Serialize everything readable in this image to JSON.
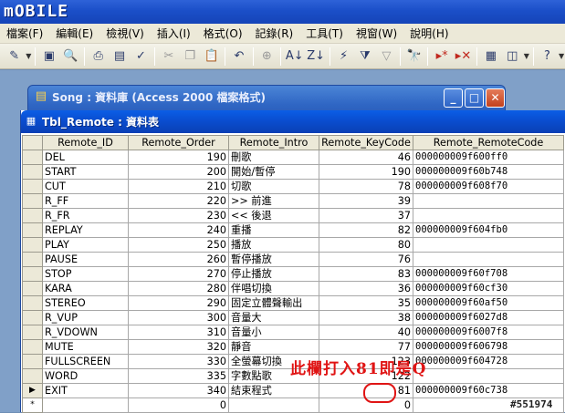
{
  "app": {
    "logo_text": "mOBILE"
  },
  "menu": {
    "items": [
      {
        "label": "檔案(F)"
      },
      {
        "label": "編輯(E)"
      },
      {
        "label": "檢視(V)"
      },
      {
        "label": "插入(I)"
      },
      {
        "label": "格式(O)"
      },
      {
        "label": "記錄(R)"
      },
      {
        "label": "工具(T)"
      },
      {
        "label": "視窗(W)"
      },
      {
        "label": "說明(H)"
      }
    ]
  },
  "toolbar": {
    "buttons": [
      {
        "name": "design-view-icon",
        "glyph": "✎"
      },
      {
        "name": "save-icon",
        "glyph": "▣"
      },
      {
        "name": "file-search-icon",
        "glyph": "🔍"
      },
      {
        "name": "print-icon",
        "glyph": "⎙"
      },
      {
        "name": "print-preview-icon",
        "glyph": "▤"
      },
      {
        "name": "spelling-icon",
        "glyph": "✓"
      },
      {
        "name": "cut-icon",
        "glyph": "✂"
      },
      {
        "name": "copy-icon",
        "glyph": "❐"
      },
      {
        "name": "paste-icon",
        "glyph": "📋"
      },
      {
        "name": "undo-icon",
        "glyph": "↶"
      },
      {
        "name": "hyperlink-icon",
        "glyph": "⊕"
      },
      {
        "name": "sort-ascending-icon",
        "glyph": "A↓"
      },
      {
        "name": "sort-descending-icon",
        "glyph": "Z↓"
      },
      {
        "name": "filter-by-selection-icon",
        "glyph": "⚡"
      },
      {
        "name": "filter-by-form-icon",
        "glyph": "⧩"
      },
      {
        "name": "apply-filter-icon",
        "glyph": "▽"
      },
      {
        "name": "find-icon",
        "glyph": "🔭"
      },
      {
        "name": "new-record-icon",
        "glyph": "▸*"
      },
      {
        "name": "delete-record-icon",
        "glyph": "▸✕"
      },
      {
        "name": "properties-icon",
        "glyph": "▦"
      },
      {
        "name": "new-object-icon",
        "glyph": "◫"
      },
      {
        "name": "help-icon",
        "glyph": "?"
      }
    ]
  },
  "db_window": {
    "title": "Song : 資料庫 (Access 2000 檔案格式)"
  },
  "table_window": {
    "title": "Tbl_Remote : 資料表"
  },
  "grid": {
    "columns": [
      "Remote_ID",
      "Remote_Order",
      "Remote_Intro",
      "Remote_KeyCode",
      "Remote_RemoteCode"
    ],
    "rows": [
      [
        "DEL",
        "190",
        "刪歌",
        "46",
        "000000009f600ff0"
      ],
      [
        "START",
        "200",
        "開始/暫停",
        "190",
        "000000009f60b748"
      ],
      [
        "CUT",
        "210",
        "切歌",
        "78",
        "000000009f608f70"
      ],
      [
        "R_FF",
        "220",
        ">> 前進",
        "39",
        ""
      ],
      [
        "R_FR",
        "230",
        "<< 後退",
        "37",
        ""
      ],
      [
        "REPLAY",
        "240",
        "重播",
        "82",
        "000000009f604fb0"
      ],
      [
        "PLAY",
        "250",
        "播放",
        "80",
        ""
      ],
      [
        "PAUSE",
        "260",
        "暫停播放",
        "76",
        ""
      ],
      [
        "STOP",
        "270",
        "停止播放",
        "83",
        "000000009f60f708"
      ],
      [
        "KARA",
        "280",
        "伴唱切換",
        "36",
        "000000009f60cf30"
      ],
      [
        "STEREO",
        "290",
        "固定立體聲輸出",
        "35",
        "000000009f60af50"
      ],
      [
        "R_VUP",
        "300",
        "音量大",
        "38",
        "000000009f6027d8"
      ],
      [
        "R_VDOWN",
        "310",
        "音量小",
        "40",
        "000000009f6007f8"
      ],
      [
        "MUTE",
        "320",
        "靜音",
        "77",
        "000000009f606798"
      ],
      [
        "FULLSCREEN",
        "330",
        "全螢幕切換",
        "123",
        "000000009f604728"
      ],
      [
        "WORD",
        "335",
        "字數點歌",
        "122",
        ""
      ],
      [
        "EXIT",
        "340",
        "結束程式",
        "81",
        "000000009f60c738"
      ]
    ],
    "new_row": {
      "selector": "*",
      "order": "0",
      "keycode": "0"
    },
    "current_row_marker": "▶"
  },
  "annotation": {
    "text": "此欄打入81即是Q"
  },
  "watermark": {
    "text": "#551974"
  },
  "colors": {
    "accent_red": "#e01414",
    "titlebar_blue": "#0a4fd2"
  }
}
